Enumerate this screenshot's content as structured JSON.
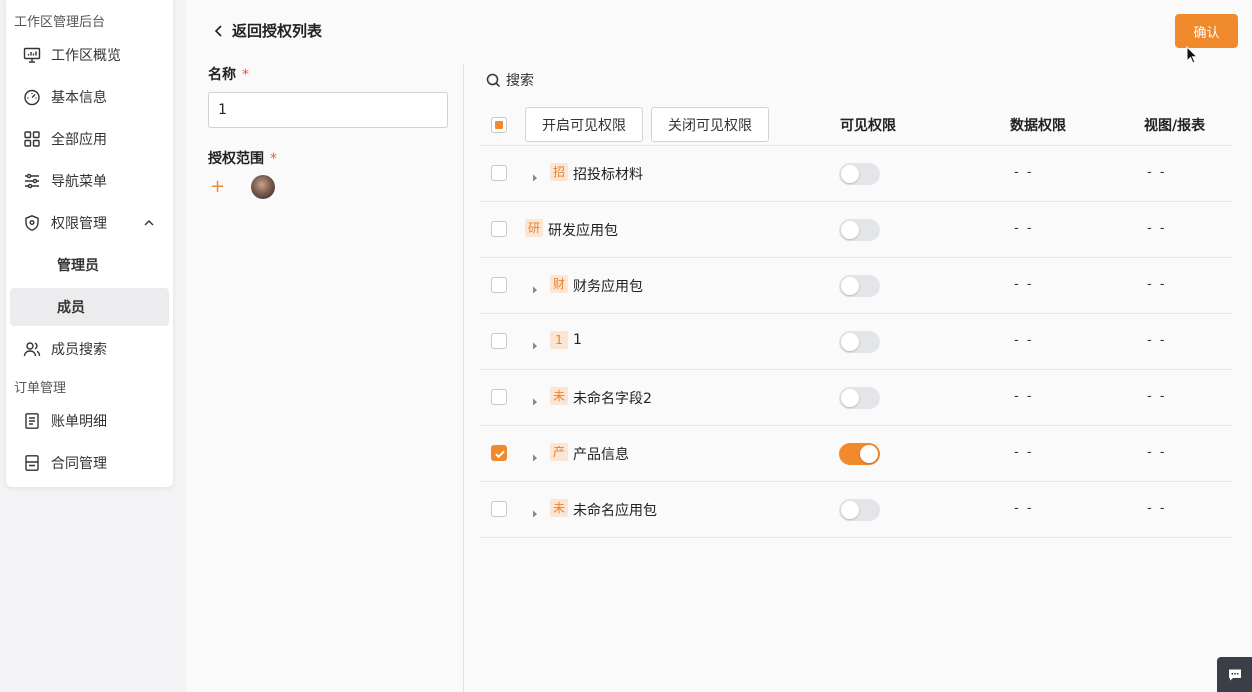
{
  "sidebar": {
    "section_workspace": "工作区管理后台",
    "section_orders": "订单管理",
    "items": [
      {
        "label": "工作区概览",
        "icon": "monitor-chart-icon"
      },
      {
        "label": "基本信息",
        "icon": "dashboard-gauge-icon"
      },
      {
        "label": "全部应用",
        "icon": "grid-apps-icon"
      },
      {
        "label": "导航菜单",
        "icon": "sliders-icon"
      },
      {
        "label": "权限管理",
        "icon": "shield-icon"
      },
      {
        "label": "管理员",
        "icon": ""
      },
      {
        "label": "成员",
        "icon": ""
      },
      {
        "label": "成员搜索",
        "icon": "users-icon"
      },
      {
        "label": "账单明细",
        "icon": "receipt-icon"
      },
      {
        "label": "合同管理",
        "icon": "contract-icon"
      }
    ],
    "active_item": "成员"
  },
  "header": {
    "back_label": "返回授权列表",
    "confirm_label": "确认"
  },
  "form": {
    "name_label": "名称",
    "name_value": "1",
    "scope_label": "授权范围",
    "required_mark": "*",
    "add_icon": "+"
  },
  "search": {
    "label": "搜索"
  },
  "table": {
    "enable_visible_btn": "开启可见权限",
    "disable_visible_btn": "关闭可见权限",
    "col_visible": "可见权限",
    "col_data": "数据权限",
    "col_view": "视图/报表",
    "rows": [
      {
        "badge": "招",
        "name": "招投标材料",
        "expandable": true,
        "checked": false,
        "visible": false,
        "data": "- -",
        "view": "- -"
      },
      {
        "badge": "研",
        "name": "研发应用包",
        "expandable": false,
        "checked": false,
        "visible": false,
        "data": "- -",
        "view": "- -"
      },
      {
        "badge": "财",
        "name": "财务应用包",
        "expandable": true,
        "checked": false,
        "visible": false,
        "data": "- -",
        "view": "- -"
      },
      {
        "badge": "1",
        "name": "1",
        "expandable": true,
        "checked": false,
        "visible": false,
        "data": "- -",
        "view": "- -"
      },
      {
        "badge": "未",
        "name": "未命名字段2",
        "expandable": true,
        "checked": false,
        "visible": false,
        "data": "- -",
        "view": "- -"
      },
      {
        "badge": "产",
        "name": "产品信息",
        "expandable": true,
        "checked": true,
        "visible": true,
        "data": "- -",
        "view": "- -"
      },
      {
        "badge": "未",
        "name": "未命名应用包",
        "expandable": true,
        "checked": false,
        "visible": false,
        "data": "- -",
        "view": "- -"
      }
    ]
  },
  "colors": {
    "accent": "#f08a2c",
    "badge_bg": "#fbe6d5"
  }
}
